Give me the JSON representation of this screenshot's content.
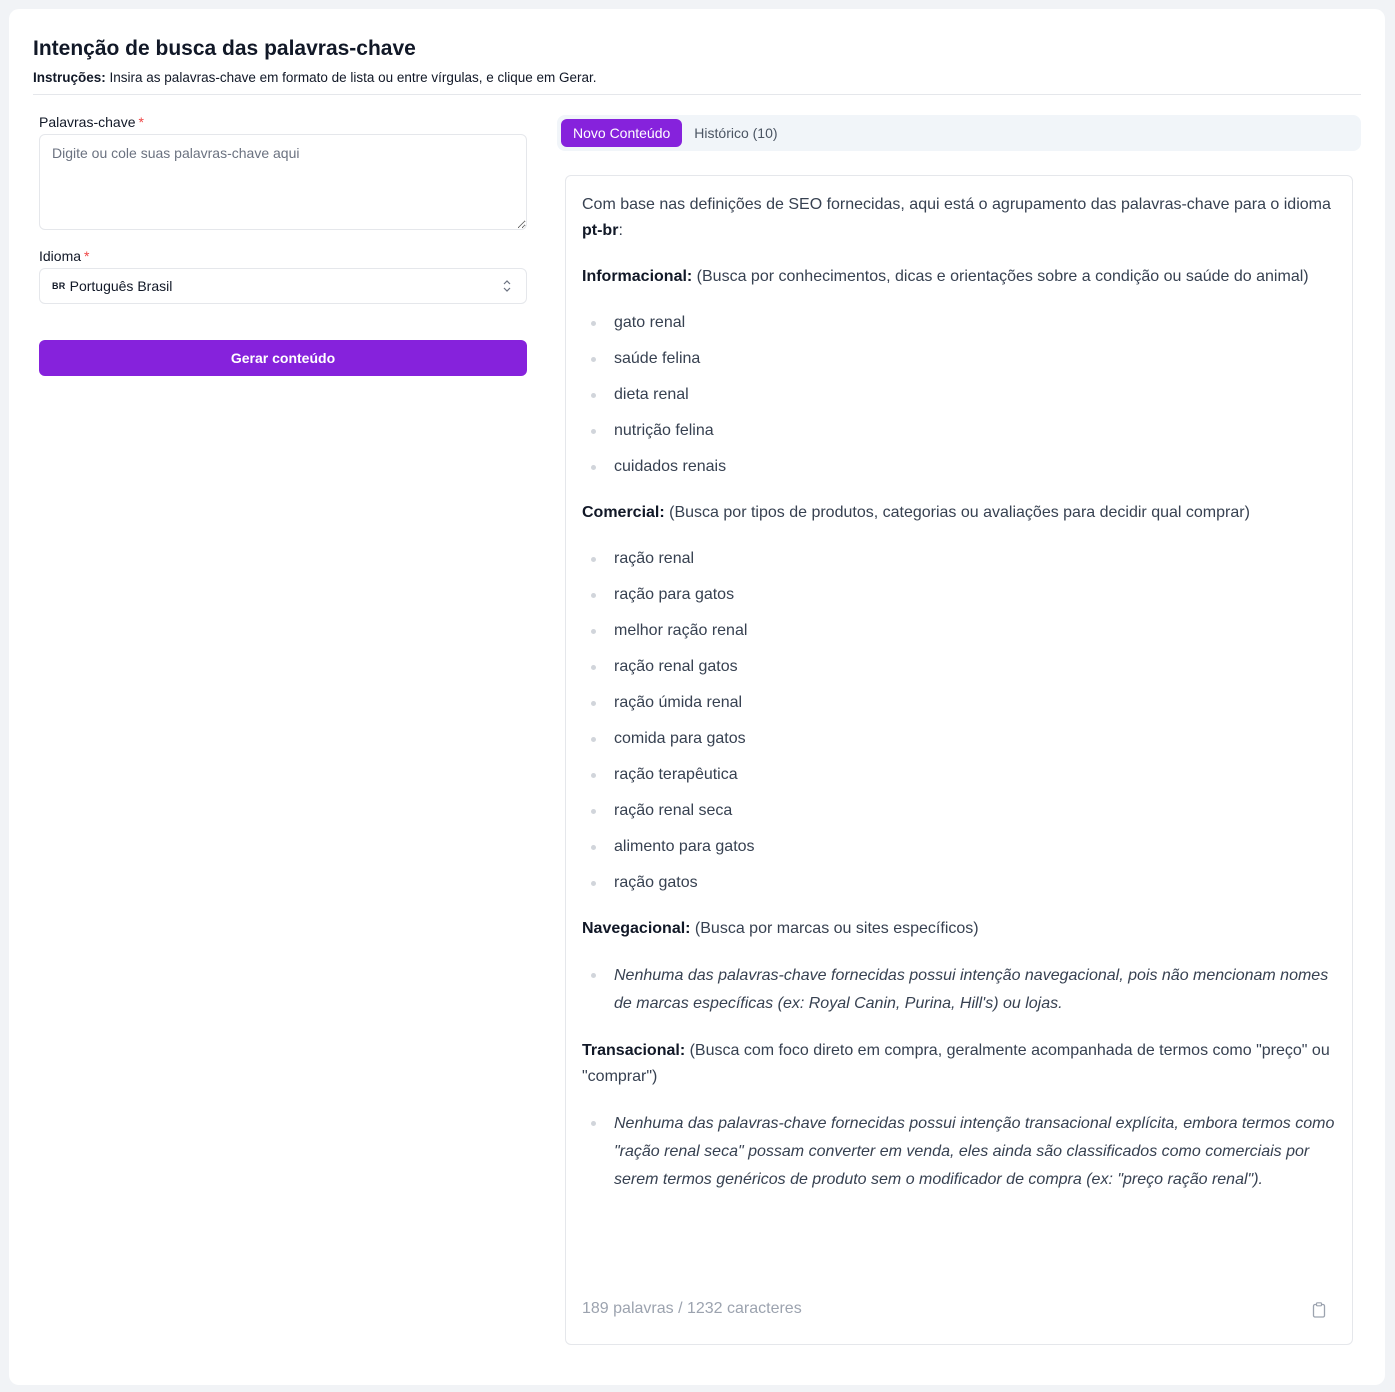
{
  "header": {
    "title": "Intenção de busca das palavras-chave",
    "instructions_label": "Instruções:",
    "instructions_text": " Insira as palavras-chave em formato de lista ou entre vírgulas, e clique em Gerar."
  },
  "form": {
    "keywords_label": "Palavras-chave",
    "keywords_placeholder": "Digite ou cole suas palavras-chave aqui",
    "keywords_value": "",
    "required_mark": "*",
    "language_label": "Idioma",
    "language_flag": "BR",
    "language_value": "Português Brasil",
    "generate_button": "Gerar conteúdo"
  },
  "tabs": [
    {
      "label": "Novo Conteúdo",
      "active": true
    },
    {
      "label": "Histórico (10)",
      "active": false
    }
  ],
  "result": {
    "intro_text": "Com base nas definições de SEO fornecidas, aqui está o agrupamento das palavras-chave para o idioma ",
    "intro_lang": "pt-br",
    "intro_end": ":",
    "sections": [
      {
        "heading": "Informacional:",
        "description": " (Busca por conhecimentos, dicas e orientações sobre a condição ou saúde do animal)",
        "italic": false,
        "items": [
          "gato renal",
          "saúde felina",
          "dieta renal",
          "nutrição felina",
          "cuidados renais"
        ]
      },
      {
        "heading": "Comercial:",
        "description": " (Busca por tipos de produtos, categorias ou avaliações para decidir qual comprar)",
        "italic": false,
        "items": [
          "ração renal",
          "ração para gatos",
          "melhor ração renal",
          "ração renal gatos",
          "ração úmida renal",
          "comida para gatos",
          "ração terapêutica",
          "ração renal seca",
          "alimento para gatos",
          "ração gatos"
        ]
      },
      {
        "heading": "Navegacional:",
        "description": " (Busca por marcas ou sites específicos)",
        "italic": true,
        "items": [
          "Nenhuma das palavras-chave fornecidas possui intenção navegacional, pois não mencionam nomes de marcas específicas (ex: Royal Canin, Purina, Hill's) ou lojas."
        ]
      },
      {
        "heading": "Transacional:",
        "description": " (Busca com foco direto em compra, geralmente acompanhada de termos como \"preço\" ou \"comprar\")",
        "italic": true,
        "items": [
          "Nenhuma das palavras-chave fornecidas possui intenção transacional explícita, embora termos como \"ração renal seca\" possam converter em venda, eles ainda são classificados como comerciais por serem termos genéricos de produto sem o modificador de compra (ex: \"preço ração renal\")."
        ]
      }
    ],
    "stats": "189 palavras / 1232 caracteres"
  },
  "colors": {
    "accent": "#8622dc",
    "required": "#ef4444",
    "muted": "#9ca3af"
  }
}
